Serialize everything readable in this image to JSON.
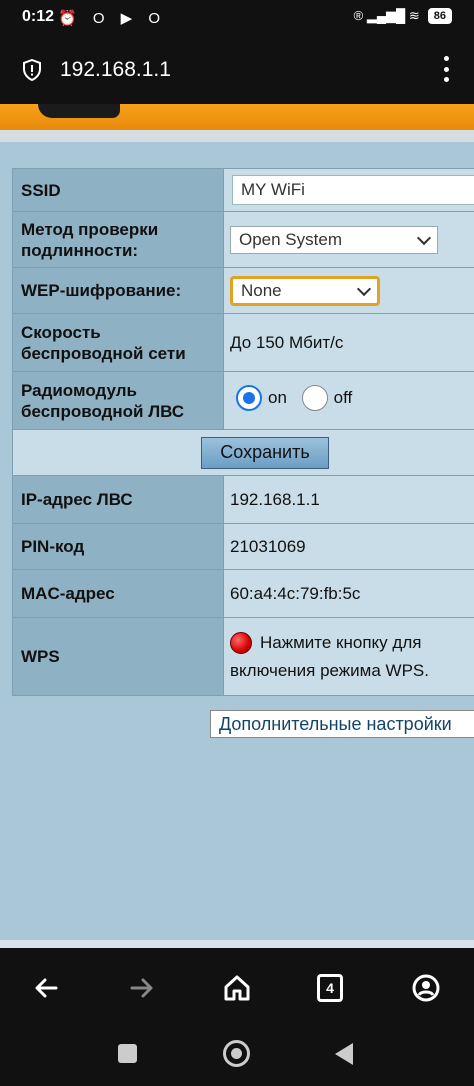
{
  "status_bar": {
    "time": "0:12",
    "left_icons": "⏰ O ▶ O",
    "right_icons": "® ▂▄▆█ ≋",
    "battery": "86"
  },
  "url_bar": {
    "url": "192.168.1.1"
  },
  "form": {
    "ssid_label": "SSID",
    "ssid_value": "MY WiFi",
    "auth_label": "Метод проверки подлинности:",
    "auth_value": "Open System",
    "wep_label": "WEP-шифрование:",
    "wep_value": "None",
    "speed_label": "Скорость беспроводной сети",
    "speed_value": "До 150 Мбит/с",
    "radio_label": "Радиомодуль беспроводной ЛВС",
    "radio_on": "on",
    "radio_off": "off",
    "save_label": "Сохранить"
  },
  "info": {
    "ip_label": "IP-адрес ЛВС",
    "ip_value": "192.168.1.1",
    "pin_label": "PIN-код",
    "pin_value": "21031069",
    "mac_label": "MAC-адрес",
    "mac_value": "60:a4:4c:79:fb:5c",
    "wps_label": "WPS",
    "wps_text": "Нажмите кнопку для включения режима WPS."
  },
  "more_settings_label": "Дополнительные настройки",
  "browser_nav": {
    "tab_count": "4"
  },
  "colors": {
    "label_bg": "#8fb1c4",
    "value_bg": "#c8dde8",
    "header_orange": "#f7a11a",
    "focus_outline": "#e1a422"
  }
}
